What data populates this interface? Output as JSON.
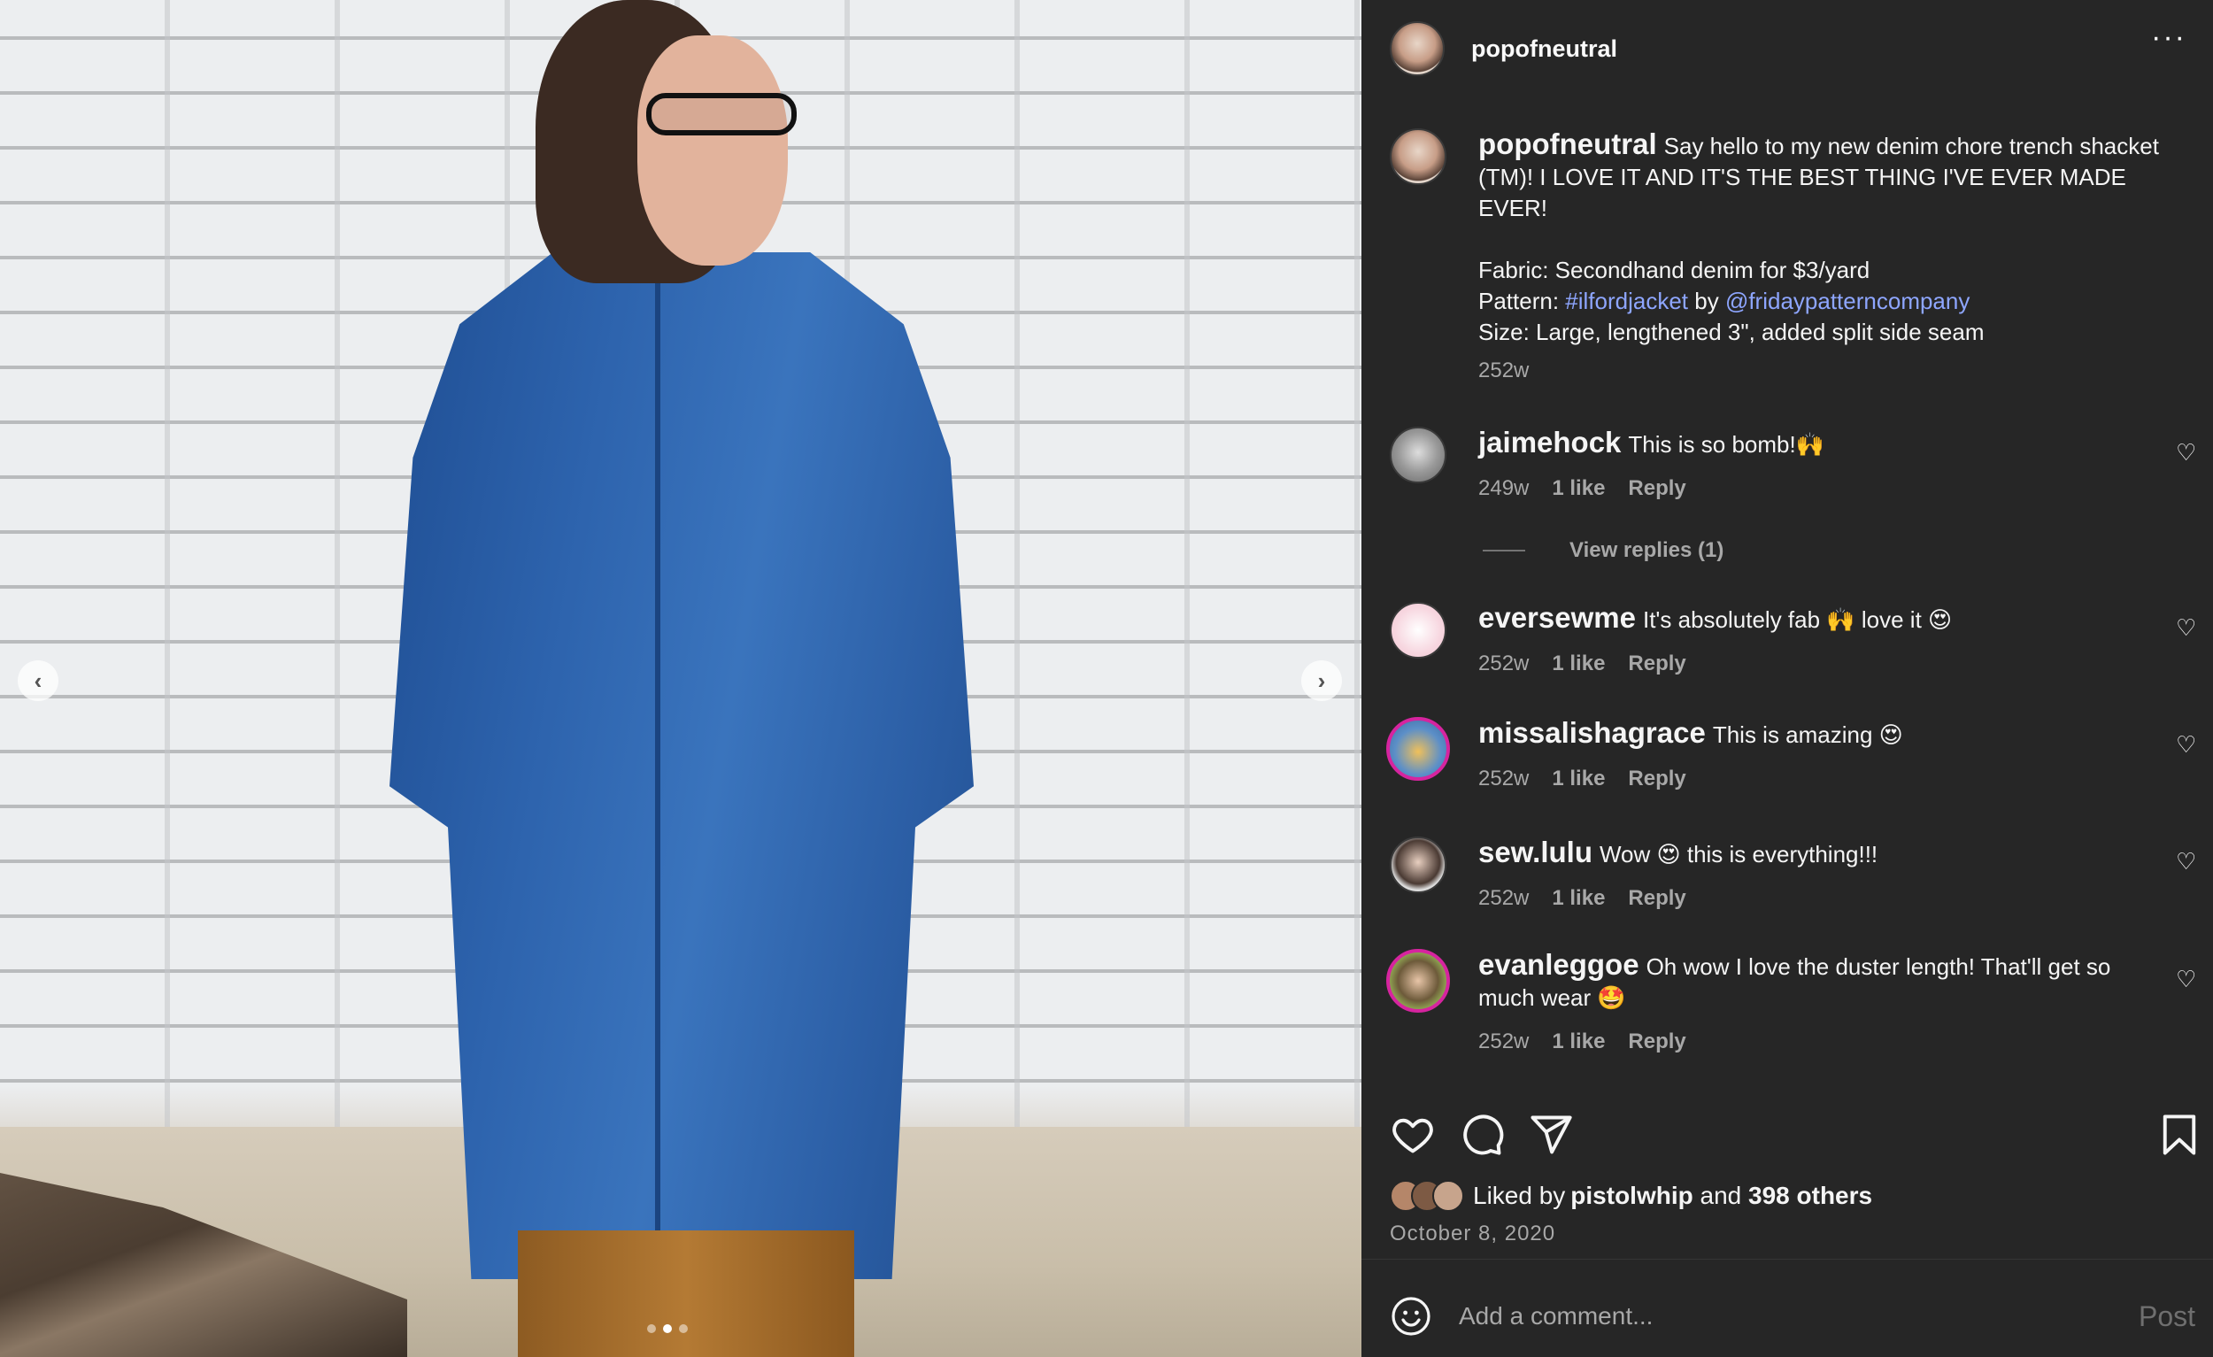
{
  "post": {
    "username": "popofneutral",
    "caption_intro": "Say hello to my new denim chore trench shacket (TM)! I LOVE IT AND IT'S THE BEST THING I'VE EVER MADE EVER!",
    "fabric_line": "Fabric: Secondhand denim for $3/yard",
    "pattern_prefix": "Pattern: ",
    "pattern_tag": "#ilfordjacket",
    "pattern_by": " by ",
    "pattern_mention": "@fridaypatterncompany",
    "size_line": "Size: Large, lengthened 3\", added split side seam",
    "age": "252w"
  },
  "comments": [
    {
      "user": "jaimehock",
      "text": "This is so bomb!🙌",
      "age": "249w",
      "likes": "1 like",
      "reply": "Reply"
    },
    {
      "user": "eversewme",
      "text": "It's absolutely fab 🙌 love it 😍",
      "age": "252w",
      "likes": "1 like",
      "reply": "Reply"
    },
    {
      "user": "missalishagrace",
      "text": "This is amazing 😍",
      "age": "252w",
      "likes": "1 like",
      "reply": "Reply"
    },
    {
      "user": "sew.lulu",
      "text": "Wow 😍 this is everything!!!",
      "age": "252w",
      "likes": "1 like",
      "reply": "Reply"
    },
    {
      "user": "evanleggoe",
      "text": "Oh wow I love the duster length! That'll get so much wear 🤩",
      "age": "252w",
      "likes": "1 like",
      "reply": "Reply"
    }
  ],
  "view_replies": "View replies (1)",
  "likes_bar": {
    "prefix": "Liked by ",
    "liker": "pistolwhip",
    "and": " and ",
    "others": "398 others"
  },
  "date": "October 8, 2020",
  "comment_box": {
    "placeholder": "Add a comment...",
    "post_label": "Post"
  },
  "icons": [
    "more-icon",
    "heart-icon",
    "comment-icon",
    "share-icon",
    "bookmark-icon",
    "emoji-icon",
    "chevron-left-icon",
    "chevron-right-icon"
  ],
  "carousel": {
    "slide_count": 3,
    "active_index": 1
  }
}
